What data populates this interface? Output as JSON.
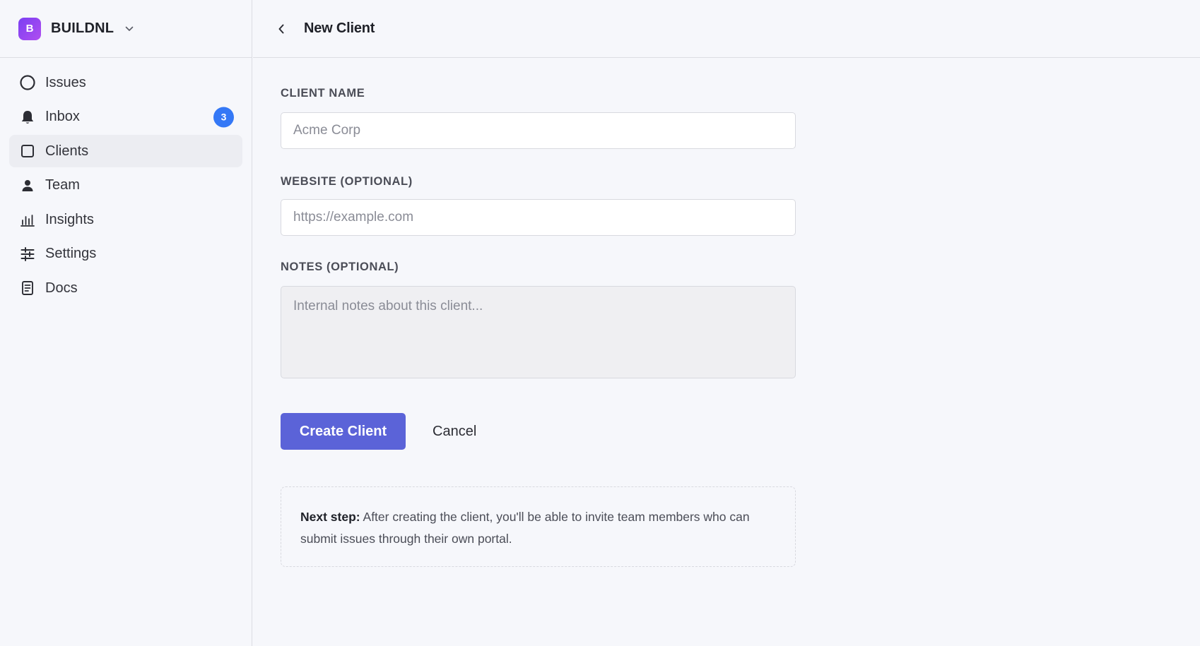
{
  "workspace": {
    "logo_letter": "B",
    "name": "BUILDNL"
  },
  "sidebar": {
    "items": [
      {
        "label": "Issues",
        "icon": "circle-icon",
        "active": false
      },
      {
        "label": "Inbox",
        "icon": "bell-icon",
        "active": false,
        "badge": "3"
      },
      {
        "label": "Clients",
        "icon": "square-icon",
        "active": true
      },
      {
        "label": "Team",
        "icon": "person-icon",
        "active": false
      },
      {
        "label": "Insights",
        "icon": "bar-chart-icon",
        "active": false
      },
      {
        "label": "Settings",
        "icon": "sliders-icon",
        "active": false
      },
      {
        "label": "Docs",
        "icon": "document-icon",
        "active": false
      }
    ]
  },
  "header": {
    "title": "New Client"
  },
  "form": {
    "client_name": {
      "label": "CLIENT NAME",
      "placeholder": "Acme Corp",
      "value": ""
    },
    "website": {
      "label": "WEBSITE (OPTIONAL)",
      "placeholder": "https://example.com",
      "value": ""
    },
    "notes": {
      "label": "NOTES (OPTIONAL)",
      "placeholder": "Internal notes about this client...",
      "value": ""
    },
    "submit_label": "Create Client",
    "cancel_label": "Cancel"
  },
  "hint": {
    "lead": "Next step:",
    "text": "After creating the client, you'll be able to invite team members who can submit issues through their own portal."
  },
  "colors": {
    "accent": "#5b63d8",
    "badge": "#3478f6",
    "logo_gradient_start": "#7b3ff2",
    "logo_gradient_end": "#b04ef0"
  }
}
